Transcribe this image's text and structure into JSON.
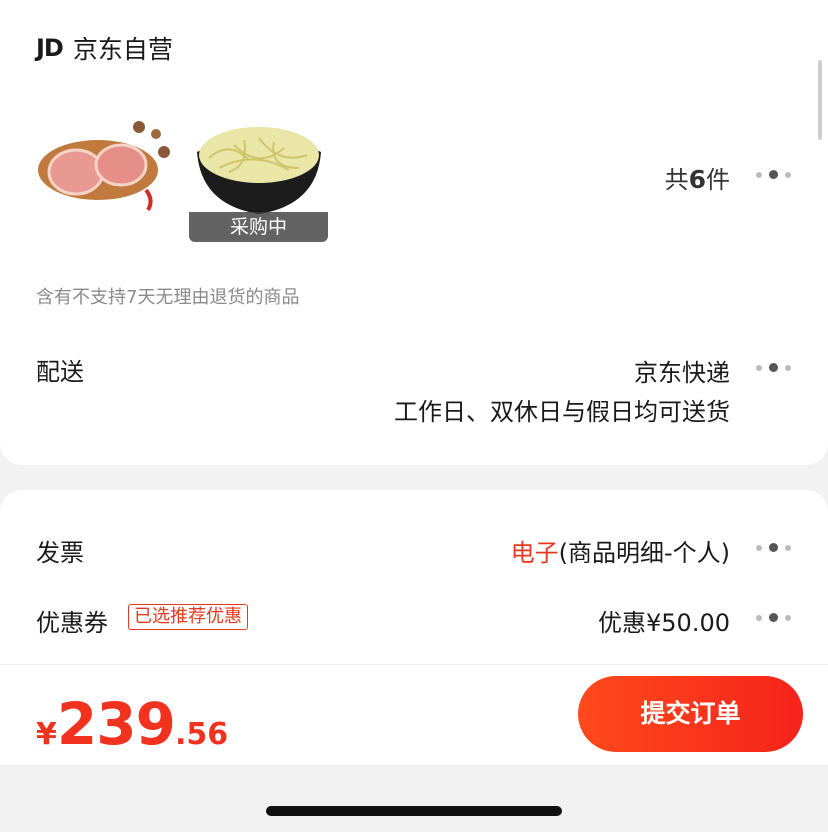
{
  "store": {
    "logo": "JD",
    "name": "京东自营",
    "badge_sprouts": "采购中",
    "count_prefix": "共",
    "count_number": "6",
    "count_suffix": "件",
    "return_note": "含有不支持7天无理由退货的商品"
  },
  "delivery": {
    "label": "配送",
    "carrier": "京东快递",
    "schedule": "工作日、双休日与假日均可送货"
  },
  "invoice": {
    "label": "发票",
    "type_highlight": "电子",
    "type_detail": "(商品明细-个人)"
  },
  "coupon": {
    "label": "优惠券",
    "tag": "已选推荐优惠",
    "value": "优惠¥50.00"
  },
  "footer": {
    "currency": "¥",
    "price_int": "239",
    "price_dec": ".56",
    "submit_label": "提交订单"
  },
  "colors": {
    "accent": "#e5391f",
    "button_start": "#ff4a1c",
    "button_end": "#f6231a"
  }
}
